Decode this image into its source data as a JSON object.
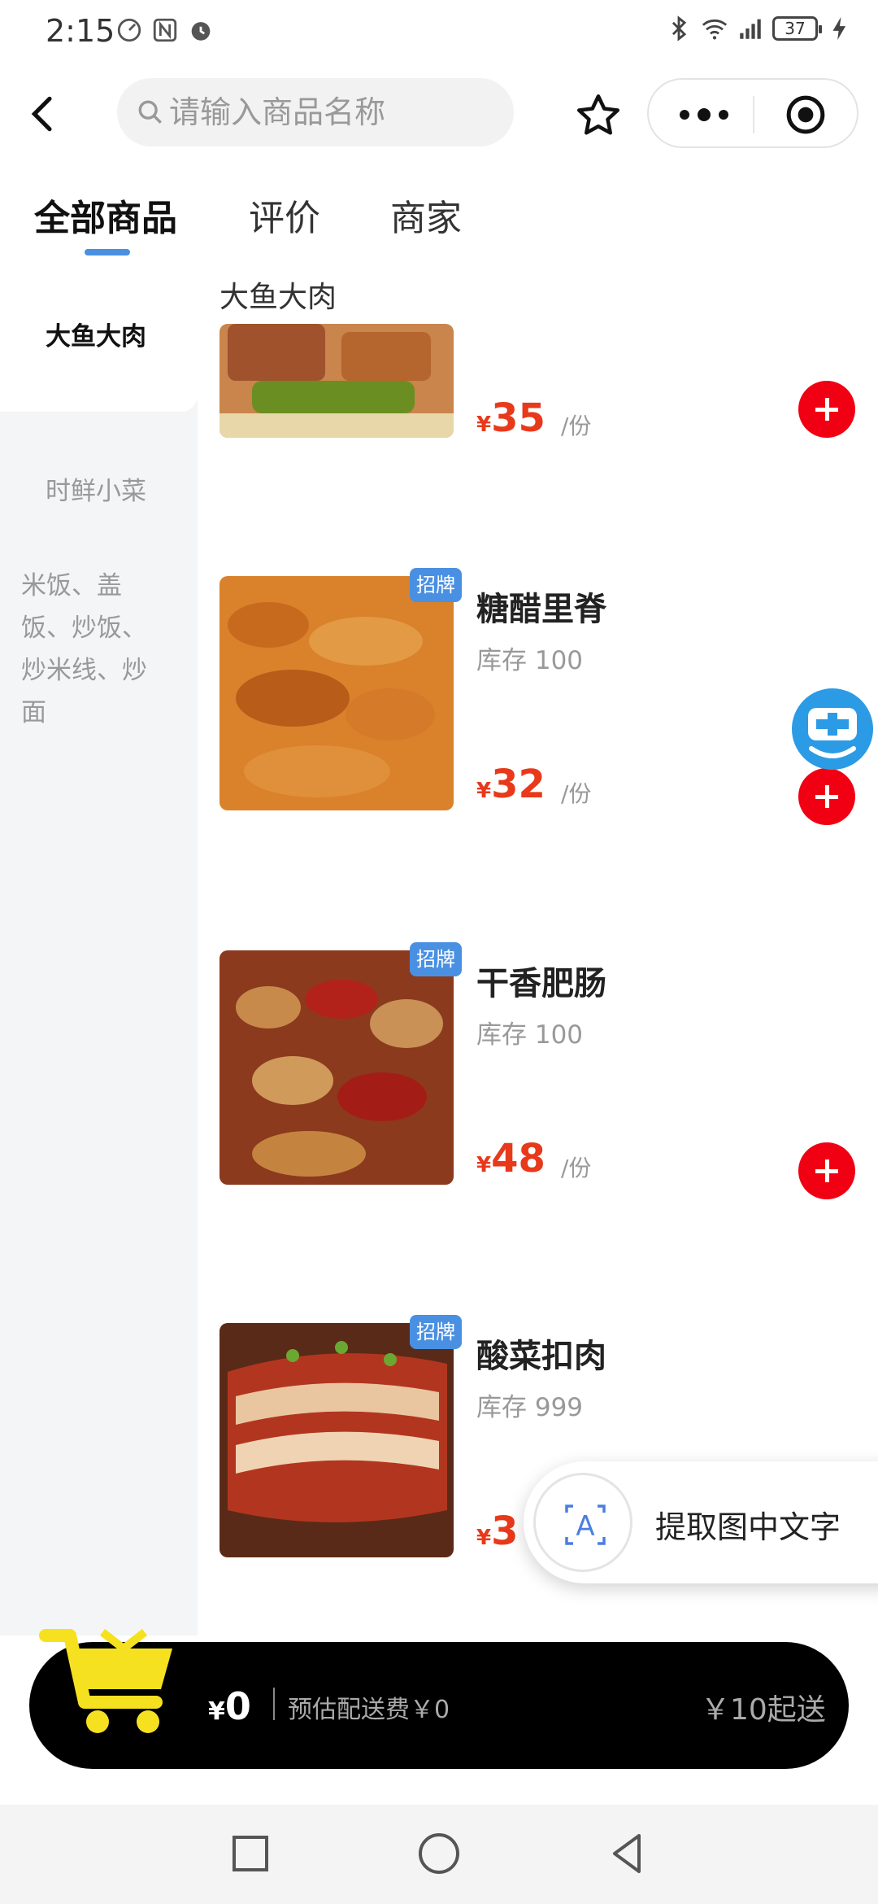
{
  "status_bar": {
    "time": "2:15",
    "battery": "37"
  },
  "search": {
    "placeholder": "请输入商品名称"
  },
  "tabs": [
    {
      "label": "全部商品"
    },
    {
      "label": "评价"
    },
    {
      "label": "商家"
    }
  ],
  "categories": [
    {
      "label": "大鱼大肉"
    },
    {
      "label": "时鲜小菜"
    },
    {
      "label": "米饭、盖饭、炒饭、炒米线、炒面"
    }
  ],
  "category_lines": {
    "line1": "米饭、盖",
    "line2": "饭、炒饭、",
    "line3": "炒米线、炒",
    "line4": "面"
  },
  "section_title": "大鱼大肉",
  "products": [
    {
      "name": "",
      "stock": "",
      "price": "35",
      "unit": "/份",
      "badge": ""
    },
    {
      "name": "糖醋里脊",
      "stock": "库存 100",
      "price": "32",
      "unit": "/份",
      "badge": "招牌"
    },
    {
      "name": "干香肥肠",
      "stock": "库存 100",
      "price": "48",
      "unit": "/份",
      "badge": "招牌"
    },
    {
      "name": "酸菜扣肉",
      "stock": "库存 999",
      "price": "3",
      "unit": "",
      "badge": "招牌"
    }
  ],
  "currency_symbol": "¥",
  "ocr_popup": {
    "label": "提取图中文字"
  },
  "cart": {
    "total": "0",
    "currency": "¥",
    "delivery_fee": "预估配送费￥0",
    "min_order": "￥10起送"
  },
  "colors": {
    "accent": "#4a90e2",
    "price": "#e8391a",
    "add_button": "#f00012",
    "cart_icon": "#f5e11f"
  }
}
